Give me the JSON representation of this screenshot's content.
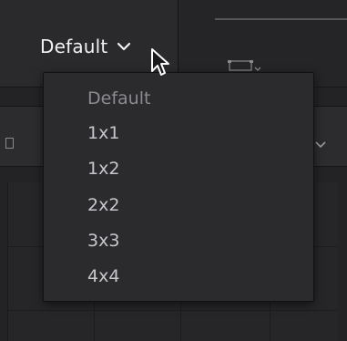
{
  "window": {
    "preset_dropdown": {
      "selected": "Default",
      "icon": "chevron-down-icon"
    },
    "cursor": "arrow-cursor-icon"
  },
  "menu": {
    "items": [
      {
        "label": "Default",
        "state": "current"
      },
      {
        "label": "1x1",
        "state": "normal"
      },
      {
        "label": "1x2",
        "state": "normal"
      },
      {
        "label": "2x2",
        "state": "normal"
      },
      {
        "label": "3x3",
        "state": "normal"
      },
      {
        "label": "4x4",
        "state": "normal"
      }
    ]
  },
  "colors": {
    "menu_background": "#2b2b2e",
    "text_primary": "#f2f2f2",
    "text_item": "#c7c7cb",
    "text_current": "#8b8b90"
  }
}
